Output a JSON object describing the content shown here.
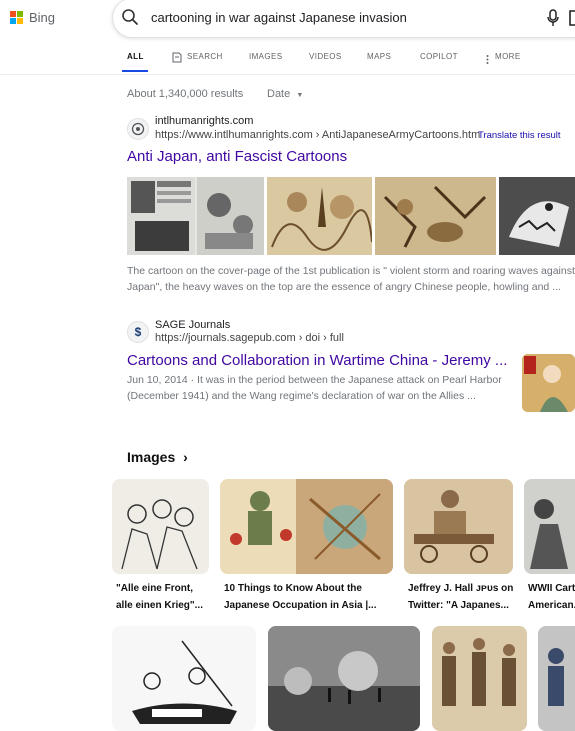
{
  "brand": {
    "name": "Bing"
  },
  "search": {
    "query": "cartooning in war against Japanese invasion"
  },
  "tabs": [
    {
      "label": "ALL",
      "active": true
    },
    {
      "label": "SEARCH",
      "icon": "copilot-search-icon"
    },
    {
      "label": "IMAGES"
    },
    {
      "label": "VIDEOS"
    },
    {
      "label": "MAPS"
    },
    {
      "label": "COPILOT"
    },
    {
      "label": "MORE",
      "icon": "vertical-dots-icon"
    }
  ],
  "results_meta": {
    "count": "About 1,340,000 results",
    "date_filter": "Date"
  },
  "results": [
    {
      "site_name": "intlhumanrights.com",
      "url": "https://www.intlhumanrights.com › AntiJapaneseArmyCartoons.htm",
      "translate": "Translate this result",
      "title": "Anti Japan, anti Fascist Cartoons",
      "snippet_1": "The cartoon on the cover-page of the 1st publication is \" violent storm and roaring waves against",
      "snippet_2": "Japan\", the heavy waves on the top are the essence of angry Chinese people, howling and ..."
    },
    {
      "site_name": "SAGE Journals",
      "url": "https://journals.sagepub.com › doi › full",
      "title": "Cartoons and Collaboration in Wartime China - Jeremy ...",
      "snippet_1": "Jun 10, 2014 · It was in the period between the Japanese attack on Pearl Harbor",
      "snippet_2": "(December 1941) and the Wang regime's declaration of war on the Allies ..."
    }
  ],
  "images_section": {
    "heading": "Images",
    "row1": [
      {
        "caption_1": "\"Alle eine Front,",
        "caption_2": "alle einen Krieg\"..."
      },
      {
        "caption_1": "10 Things to Know About the",
        "caption_2": "Japanese Occupation in Asia |..."
      },
      {
        "caption_1": "Jeffrey J. Hall ᴊᴘᴜs on",
        "caption_2": "Twitter: \"A Japanes..."
      },
      {
        "caption_1": "WWII Cart",
        "caption_2": "American..."
      }
    ]
  },
  "colors": {
    "link": "#4007a2",
    "accent": "#174ae4",
    "muted": "#70757a"
  }
}
